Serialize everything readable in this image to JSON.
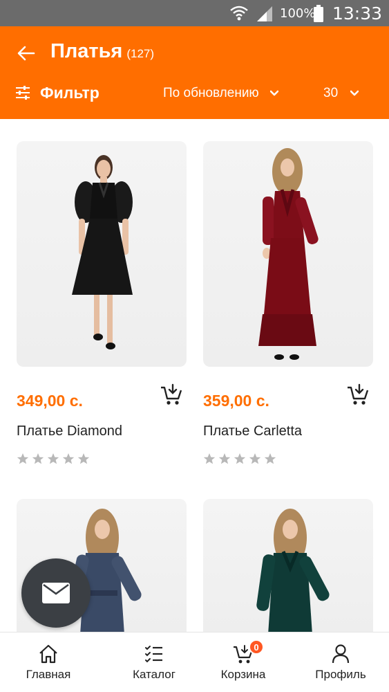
{
  "status_bar": {
    "battery_text": "100%",
    "time": "13:33",
    "icons": [
      "wifi-icon",
      "signal-icon",
      "battery-icon"
    ]
  },
  "header": {
    "title": "Платья",
    "count": "(127)",
    "back_icon": "arrow-left-icon",
    "filter_label": "Фильтр",
    "filter_icon": "sliders-icon",
    "sort_label": "По обновлению",
    "per_page_label": "30",
    "background_color": "#ff6e00"
  },
  "products": [
    {
      "price": "349,00 с.",
      "name": "Платье Diamond",
      "rating": 0,
      "max_rating": 5,
      "image": "black dress photo"
    },
    {
      "price": "359,00 с.",
      "name": "Платье Carletta",
      "rating": 0,
      "max_rating": 5,
      "image": "burgundy velvet dress photo"
    },
    {
      "image": "blue velvet dress photo"
    },
    {
      "image": "green velvet dress photo"
    }
  ],
  "fab": {
    "icon": "mail-icon"
  },
  "bottom_nav": {
    "items": [
      {
        "label": "Главная",
        "icon": "home-icon"
      },
      {
        "label": "Каталог",
        "icon": "catalog-list-icon"
      },
      {
        "label": "Корзина",
        "icon": "cart-icon",
        "badge": "0"
      },
      {
        "label": "Профиль",
        "icon": "user-icon"
      }
    ]
  },
  "colors": {
    "accent": "#ff6e00",
    "price": "#ff6e00",
    "badge": "#ff5722",
    "star_empty": "#b8b8b8",
    "status_bar": "#6b6b6b"
  }
}
